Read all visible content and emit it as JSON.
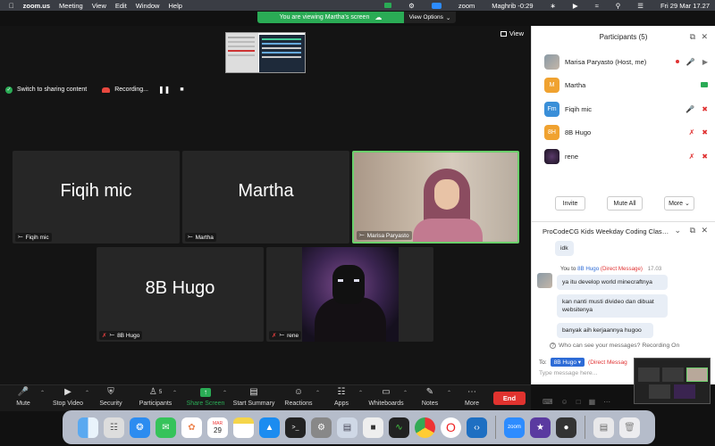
{
  "menubar": {
    "app": "zoom.us",
    "items": [
      "Meeting",
      "View",
      "Edit",
      "Window",
      "Help"
    ],
    "zoom_label": "zoom",
    "prayer": "Maghrib -0:29",
    "datetime": "Fri 29 Mar 17.27"
  },
  "share_banner": {
    "text": "You are viewing Martha's screen",
    "view_options": "View Options"
  },
  "view_button": "View",
  "share_status": {
    "switch_label": "Switch to sharing content",
    "recording_label": "Recording..."
  },
  "tiles": [
    {
      "name": "Fiqih mic",
      "label": "Fiqih mic"
    },
    {
      "name": "Martha",
      "label": "Martha"
    },
    {
      "name": "",
      "label": "Marisa Paryasto"
    },
    {
      "name": "8B Hugo",
      "label": "8B Hugo"
    },
    {
      "name": "",
      "label": "rene"
    }
  ],
  "toolbar": {
    "mute": "Mute",
    "stop_video": "Stop Video",
    "security": "Security",
    "participants": "Participants",
    "participants_count": "5",
    "share_screen": "Share Screen",
    "start_summary": "Start Summary",
    "reactions": "Reactions",
    "apps": "Apps",
    "whiteboards": "Whiteboards",
    "notes": "Notes",
    "more": "More",
    "end": "End"
  },
  "participants_panel": {
    "title": "Participants (5)",
    "people": [
      {
        "name": "Marisa Paryasto (Host, me)",
        "initials": ""
      },
      {
        "name": "Martha",
        "initials": "M"
      },
      {
        "name": "Fiqih mic",
        "initials": "Fm"
      },
      {
        "name": "8B Hugo",
        "initials": "8H"
      },
      {
        "name": "rene",
        "initials": ""
      }
    ],
    "invite": "Invite",
    "mute_all": "Mute All",
    "more": "More"
  },
  "chat": {
    "title": "ProCodeCG Kids Weekday Coding Class...",
    "first_msg": "idk",
    "meta_you": "You to",
    "meta_to": "8B Hugo",
    "meta_dm": "(Direct Message)",
    "meta_time": "17.03",
    "messages": [
      "ya itu develop world minecraftnya",
      "kan nanti musti divideo dan dibuat websitenya",
      "banyak aih kerjaannya hugoo"
    ],
    "who_can_see": "Who can see your messages? Recording On",
    "to_label": "To:",
    "to_chip": "8B Hugo",
    "to_dm": "(Direct Messag",
    "placeholder": "Type message here..."
  },
  "colors": {
    "accent_green": "#2aab55",
    "end_red": "#e0332f",
    "link_blue": "#2d6bd6",
    "active_speaker_border": "#6bd06b"
  },
  "icons": [
    "mic-icon",
    "video-icon",
    "shield-icon",
    "people-icon",
    "share-arrow-icon",
    "summary-icon",
    "reaction-icon",
    "apps-icon",
    "whiteboard-icon",
    "notes-icon",
    "more-icon",
    "pin-icon",
    "mute-icon",
    "popout-icon",
    "close-icon"
  ]
}
